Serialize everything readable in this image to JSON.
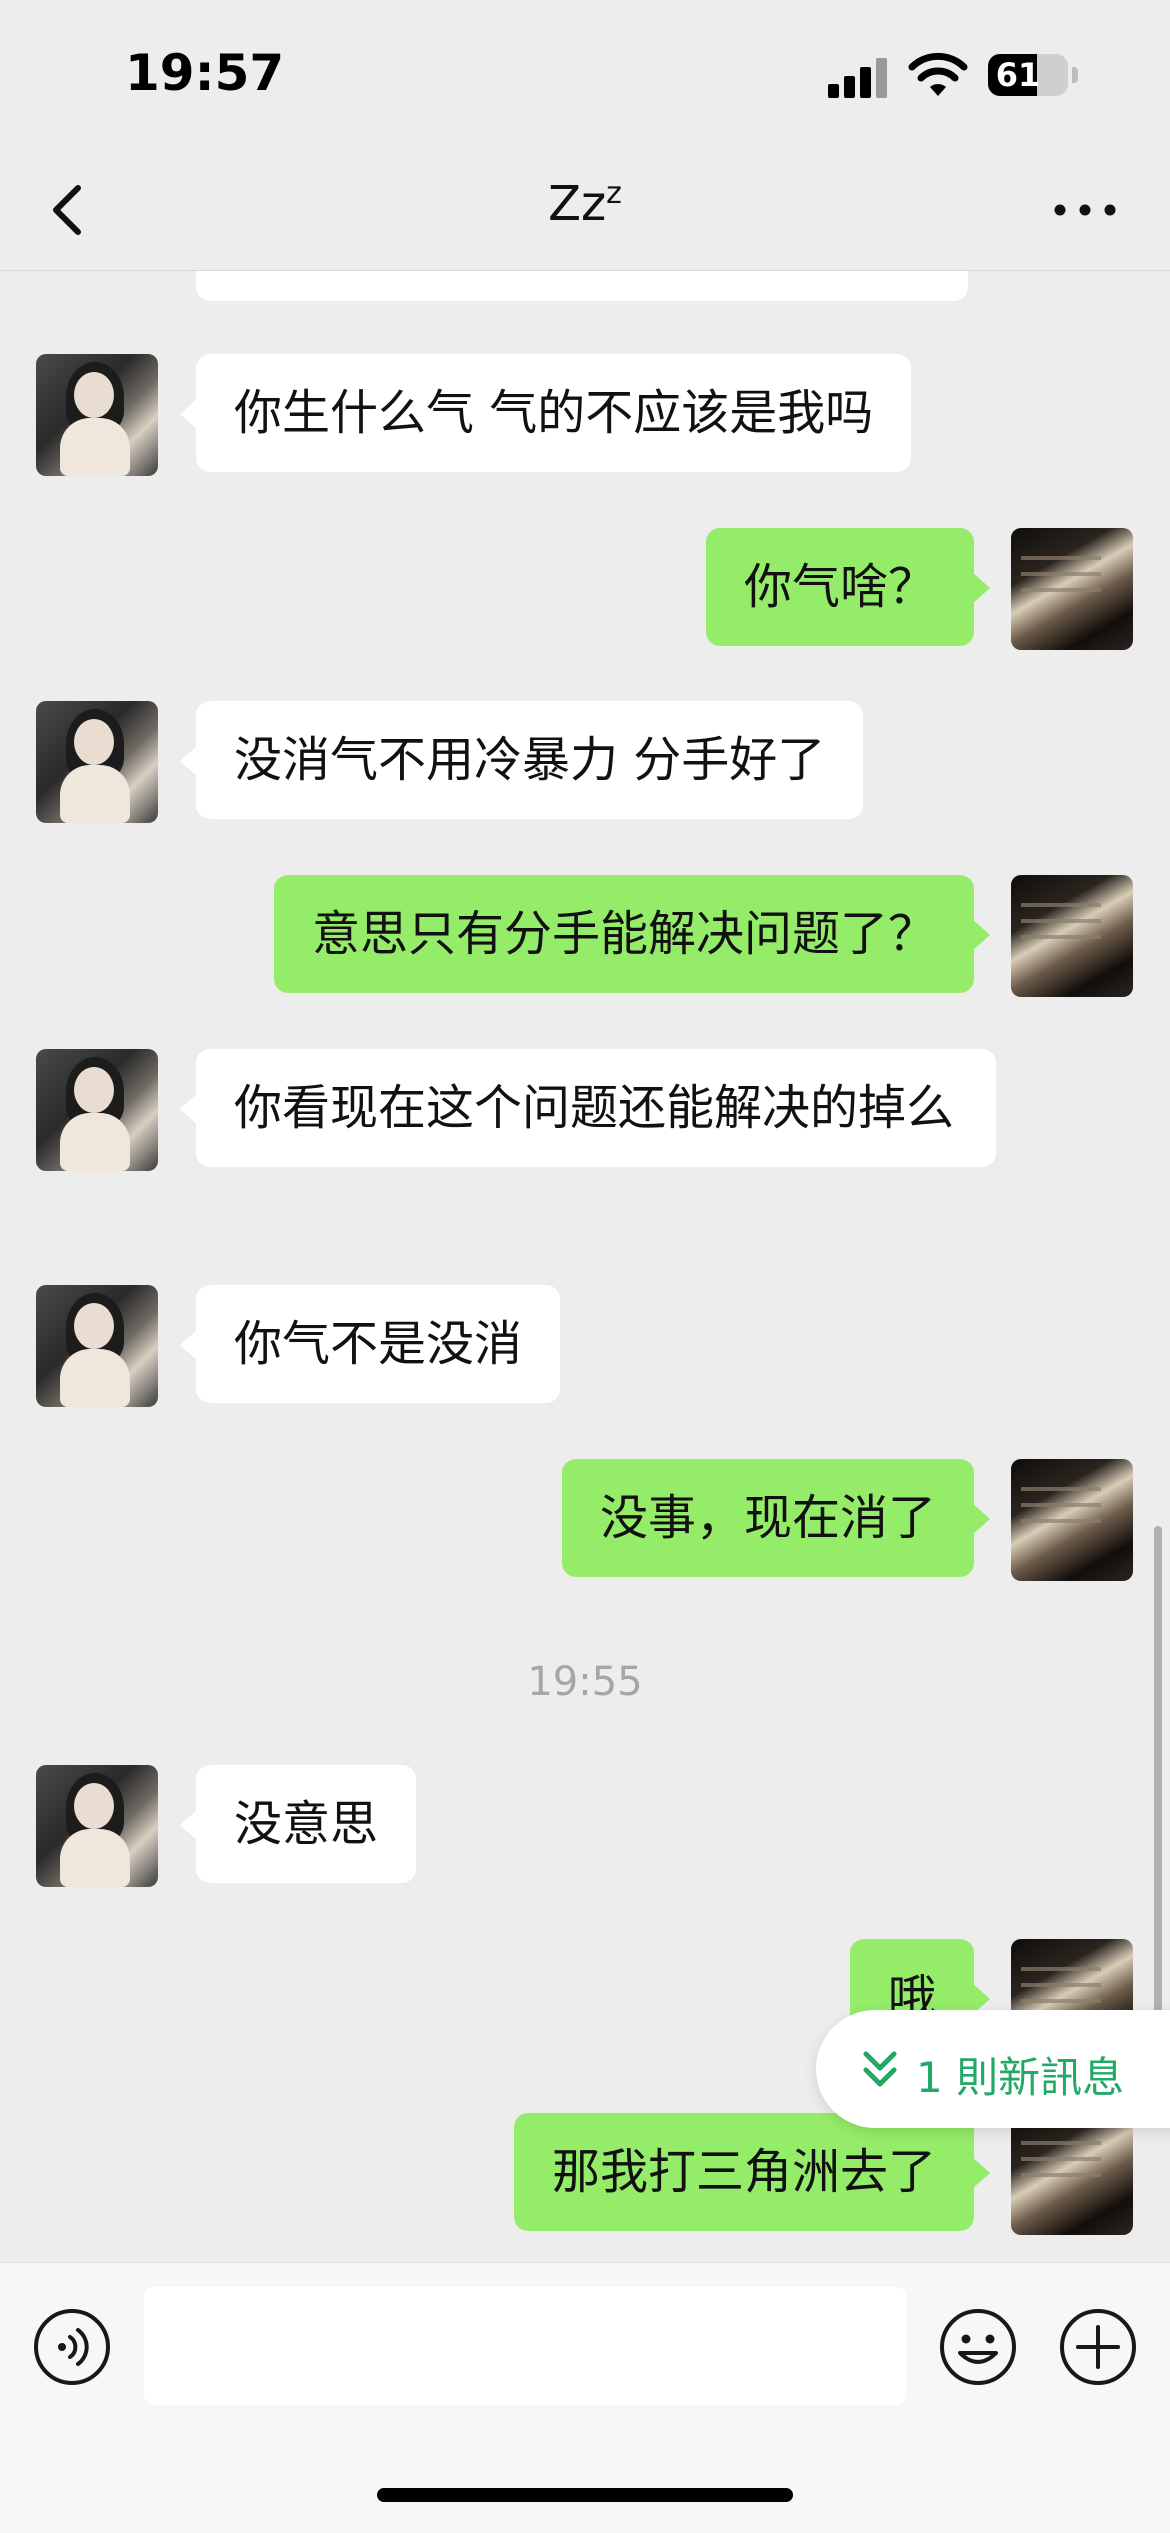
{
  "status_bar": {
    "time": "19:57",
    "battery_percent": "61",
    "battery_level": 0.61
  },
  "nav": {
    "title": "Zz",
    "title_superscript": "z"
  },
  "messages": [
    {
      "sender": "her",
      "text": "你生什么气 气的不应该是我吗"
    },
    {
      "sender": "me",
      "text": "你气啥？"
    },
    {
      "sender": "her",
      "text": "没消气不用冷暴力 分手好了"
    },
    {
      "sender": "me",
      "text": "意思只有分手能解决问题了？"
    },
    {
      "sender": "her",
      "text": "你看现在这个问题还能解决的掉么"
    },
    {
      "sender": "her",
      "text": "你气不是没消"
    },
    {
      "sender": "me",
      "text": "没事，现在消了"
    },
    {
      "sender": "her",
      "text": "没意思"
    },
    {
      "sender": "me",
      "text": "哦"
    },
    {
      "sender": "me",
      "text": "那我打三角洲去了"
    }
  ],
  "timestamp": "19:55",
  "new_message_pill": {
    "label": "1 則新訊息"
  },
  "input_bar": {
    "value": "",
    "placeholder": ""
  },
  "colors": {
    "background": "#ededed",
    "bubble_incoming": "#ffffff",
    "bubble_outgoing": "#95ec69",
    "accent_green": "#24a868"
  },
  "icons": {
    "back": "chevron-left-icon",
    "more": "ellipsis-icon",
    "voice": "voice-icon",
    "emoji": "smiley-icon",
    "plus": "plus-icon",
    "new_messages": "double-chevron-down-icon"
  }
}
